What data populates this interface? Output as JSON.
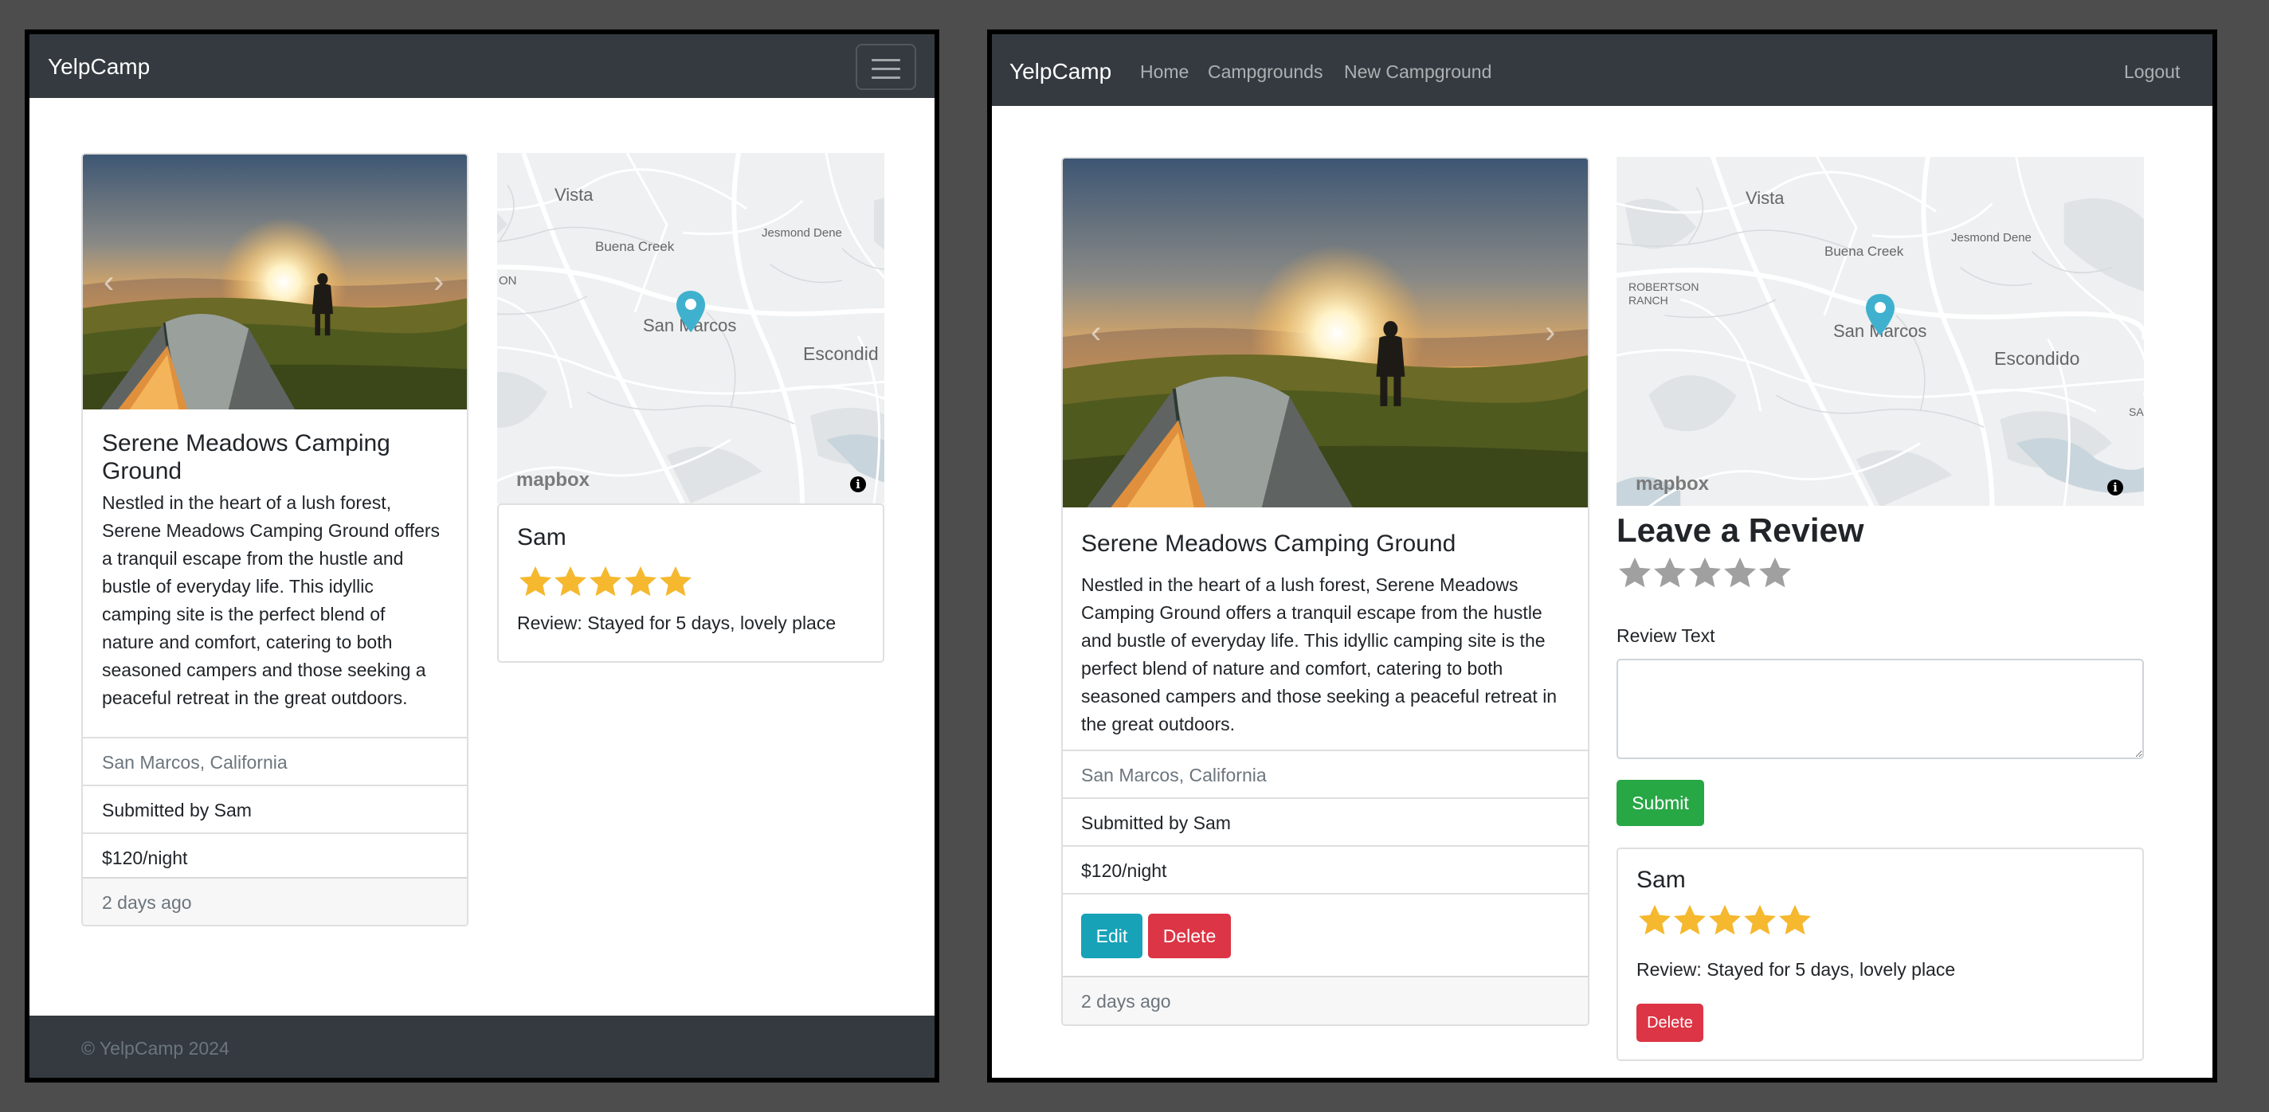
{
  "brand": "YelpCamp",
  "nav": {
    "home": "Home",
    "campgrounds": "Campgrounds",
    "new_campground": "New Campground",
    "logout": "Logout"
  },
  "campground": {
    "title": "Serene Meadows Camping Ground",
    "title_line1": "Serene Meadows Camping",
    "title_line2": "Ground",
    "description_lines_mobile": [
      "Nestled in the heart of a lush forest,",
      "Serene Meadows Camping Ground offers",
      "a tranquil escape from the hustle and",
      "bustle of everyday life. This idyllic",
      "camping site is the perfect blend of",
      "nature and comfort, catering to both",
      "seasoned campers and those seeking a",
      "peaceful retreat in the great outdoors."
    ],
    "description_lines_desktop": [
      "Nestled in the heart of a lush forest, Serene Meadows",
      "Camping Ground offers a tranquil escape from the hustle",
      "and bustle of everyday life. This idyllic camping site is the",
      "perfect blend of nature and comfort, catering to both",
      "seasoned campers and those seeking a peaceful retreat in",
      "the great outdoors."
    ],
    "location": "San Marcos, California",
    "submitted_by": "Submitted by Sam",
    "price": "$120/night",
    "posted": "2 days ago",
    "carousel_prev": "‹",
    "carousel_next": "›"
  },
  "map": {
    "labels": {
      "vista": "Vista",
      "buena_creek": "Buena Creek",
      "jesmond_dene": "Jesmond Dene",
      "san_marcos": "San Marcos",
      "escondido_mobile": "Escondid",
      "escondido": "Escondido",
      "robertson_line1": "ROBERTSON",
      "robertson_line2": "RANCH",
      "on_fragment": "ON",
      "sa_fragment": "SA"
    },
    "logo": "mapbox",
    "info": "i",
    "pin_color": "#3fb1ce"
  },
  "review": {
    "author": "Sam",
    "rating": 5,
    "text": "Review: Stayed for 5 days, lovely place",
    "star_color": "#f5b82e"
  },
  "review_form": {
    "heading": "Leave a Review",
    "empty_star_color": "#a0a0a0",
    "label": "Review Text",
    "text_value": "",
    "submit": "Submit"
  },
  "actions": {
    "edit": "Edit",
    "delete": "Delete",
    "review_delete": "Delete"
  },
  "footer": "© YelpCamp 2024",
  "colors": {
    "navbar": "#343a40",
    "info_btn": "#17a2b8",
    "danger_btn": "#dc3545",
    "success_btn": "#28a745"
  }
}
